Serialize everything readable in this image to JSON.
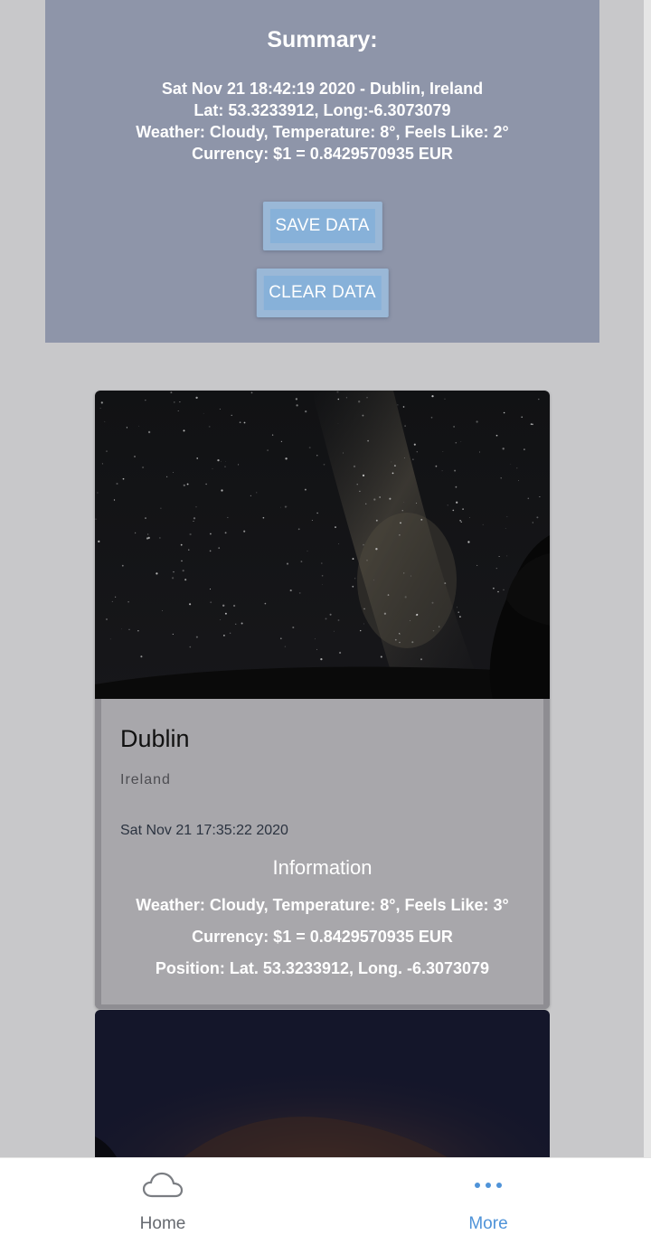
{
  "summary": {
    "title": "Summary:",
    "line1": "Sat Nov 21 18:42:19 2020 - Dublin, Ireland",
    "line2": "Lat: 53.3233912, Long:-6.3073079",
    "line3": "Weather: Cloudy, Temperature: 8°, Feels Like: 2°",
    "line4": "Currency: $1 = 0.8429570935 EUR",
    "save_label": "SAVE DATA",
    "clear_label": "CLEAR DATA"
  },
  "cards": [
    {
      "title": "Dublin",
      "subtitle": "Ireland",
      "date": "Sat Nov 21 17:35:22 2020",
      "info_heading": "Information",
      "weather": "Weather: Cloudy, Temperature: 8°, Feels Like: 3°",
      "currency": "Currency: $1 = 0.8429570935 EUR",
      "position": "Position: Lat. 53.3233912, Long. -6.3073079"
    }
  ],
  "tabs": [
    {
      "label": "Home",
      "icon": "cloud-icon",
      "active": false
    },
    {
      "label": "More",
      "icon": "more-dots-icon",
      "active": true
    }
  ],
  "colors": {
    "background": "#c8c8ca",
    "summary_panel": "#8e95a9",
    "button": "#87b1d9",
    "card_body": "#a8a7ab",
    "tab_active": "#4f93d8",
    "tab_inactive": "#666a70"
  }
}
